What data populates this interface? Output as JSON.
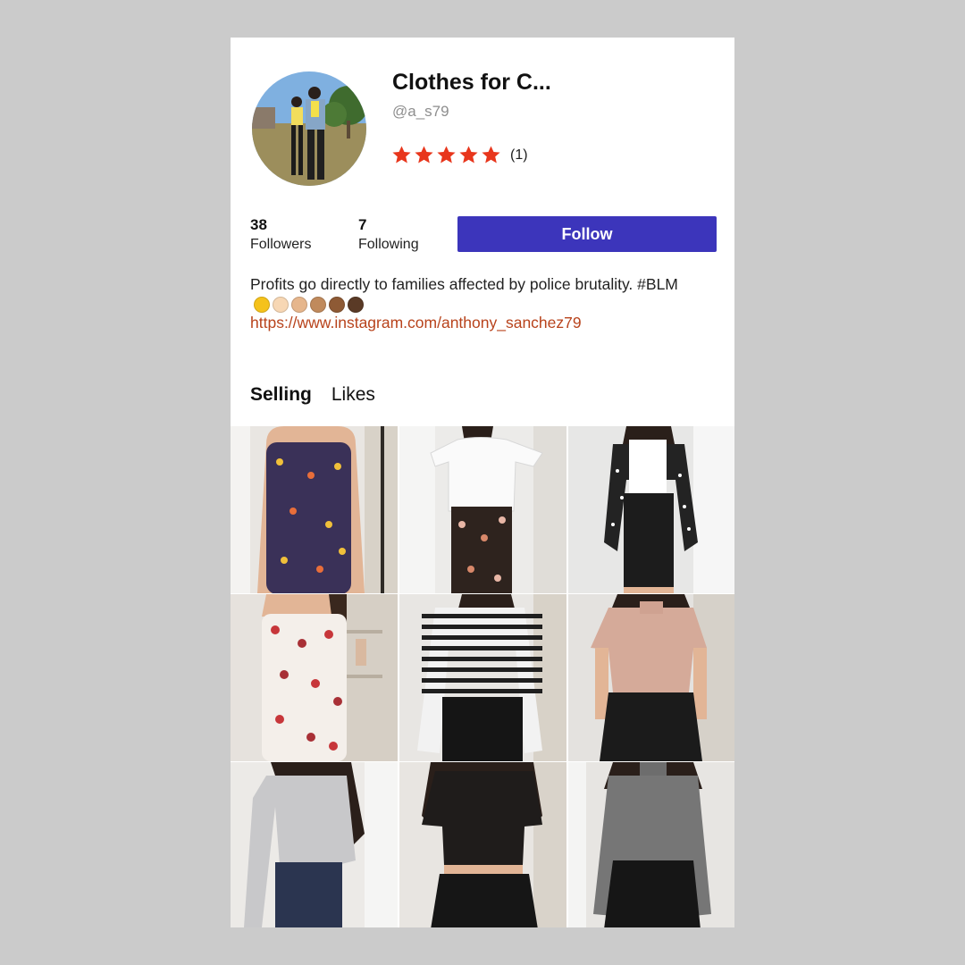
{
  "profile": {
    "name": "Clothes for C...",
    "handle": "@a_s79",
    "rating_stars": 5,
    "rating_count": "(1)",
    "followers_count": "38",
    "followers_label": "Followers",
    "following_count": "7",
    "following_label": "Following",
    "follow_label": "Follow",
    "bio": "Profits go directly to families affected by police brutality. #BLM",
    "bio_emoji_icons": [
      "raised-fist-yellow",
      "raised-fist-light",
      "raised-fist-medium-light",
      "raised-fist-medium",
      "raised-fist-medium-dark",
      "raised-fist-dark"
    ],
    "link": "https://www.instagram.com/anthony_sanchez79"
  },
  "tabs": [
    {
      "label": "Selling",
      "active": true
    },
    {
      "label": "Likes",
      "active": false
    }
  ],
  "listings": [
    {
      "item": "strapless floral romper"
    },
    {
      "item": "white off-shoulder top"
    },
    {
      "item": "polka dot cardigan"
    },
    {
      "item": "floral tube romper"
    },
    {
      "item": "striped long sleeve top"
    },
    {
      "item": "pink mock neck crop top"
    },
    {
      "item": "grey long sleeve crop top"
    },
    {
      "item": "black crop top"
    },
    {
      "item": "grey turtleneck crop top"
    }
  ],
  "colors": {
    "accent": "#3c35bb",
    "star": "#e8361c",
    "link": "#b8431c",
    "page_bg": "#cbcbcb"
  }
}
